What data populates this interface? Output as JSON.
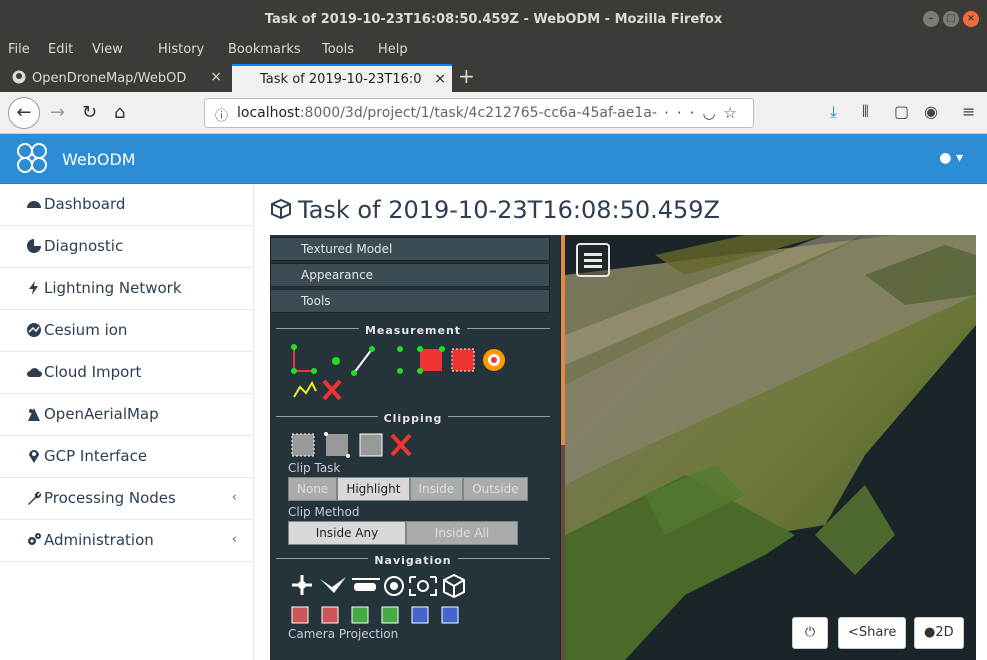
{
  "window": {
    "title": "Task of 2019-10-23T16:08:50.459Z - WebODM - Mozilla Firefox"
  },
  "menubar": [
    "File",
    "Edit",
    "View",
    "History",
    "Bookmarks",
    "Tools",
    "Help"
  ],
  "tabs": [
    {
      "label": "OpenDroneMap/WebOD",
      "active": false
    },
    {
      "label": "Task of 2019-10-23T16:0",
      "active": true
    }
  ],
  "urlbar": {
    "host": "localhost",
    "path": ":8000/3d/project/1/task/4c212765-cc6a-45af-ae1a-3"
  },
  "app": {
    "brand": "WebODM",
    "accent": "#2c8cd4"
  },
  "sidebar": {
    "items": [
      {
        "label": "Dashboard",
        "icon": "tachometer-icon"
      },
      {
        "label": "Diagnostic",
        "icon": "pie-chart-icon"
      },
      {
        "label": "Lightning Network",
        "icon": "bolt-icon"
      },
      {
        "label": "Cesium ion",
        "icon": "cesium-icon"
      },
      {
        "label": "Cloud Import",
        "icon": "cloud-upload-icon"
      },
      {
        "label": "OpenAerialMap",
        "icon": "oam-icon"
      },
      {
        "label": "GCP Interface",
        "icon": "map-marker-icon"
      },
      {
        "label": "Processing Nodes",
        "icon": "wrench-icon",
        "chevron": "‹"
      },
      {
        "label": "Administration",
        "icon": "cogs-icon",
        "chevron": "‹"
      }
    ]
  },
  "page": {
    "title": "Task of 2019-10-23T16:08:50.459Z"
  },
  "viewer": {
    "accordions": [
      "Textured Model",
      "Appearance",
      "Tools"
    ],
    "sections": {
      "measurement": "Measurement",
      "clipping": "Clipping",
      "navigation": "Navigation"
    },
    "clip_task": {
      "label": "Clip Task",
      "options": [
        "None",
        "Highlight",
        "Inside",
        "Outside"
      ],
      "selected": "Highlight"
    },
    "clip_method": {
      "label": "Clip Method",
      "options": [
        "Inside Any",
        "Inside All"
      ],
      "selected": "Inside Any"
    },
    "camera_projection": "Camera Projection",
    "buttons": {
      "share": "Share",
      "twod": "2D"
    }
  }
}
